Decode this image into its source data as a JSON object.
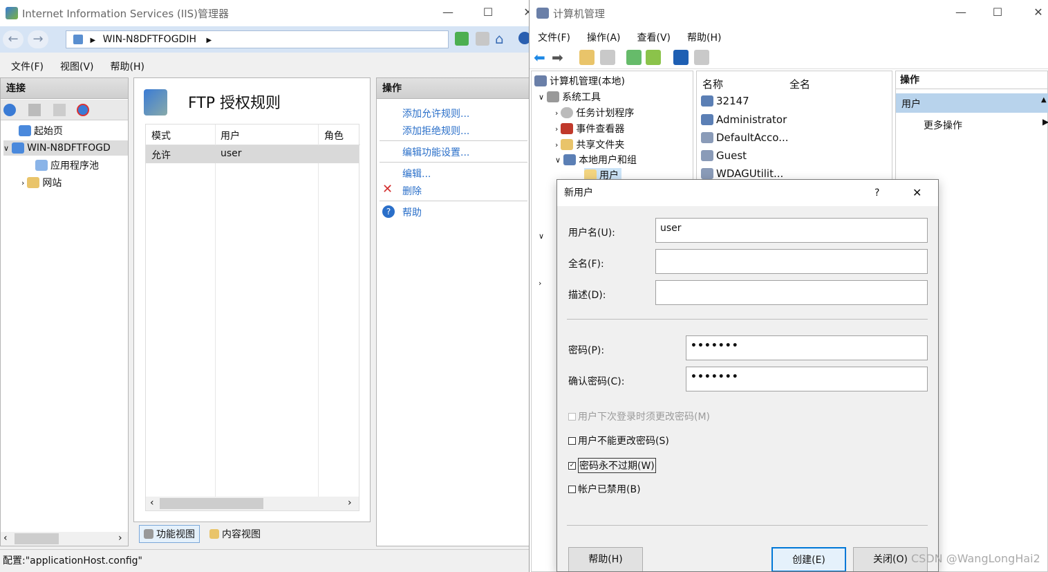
{
  "iis": {
    "title": "Internet Information Services (IIS)管理器",
    "address": "WIN-N8DFTFOGDIH",
    "menu": [
      "文件(F)",
      "视图(V)",
      "帮助(H)"
    ],
    "connections_header": "连接",
    "tree": {
      "start_page": "起始页",
      "server": "WIN-N8DFTFOGD",
      "app_pools": "应用程序池",
      "sites": "网站"
    },
    "content": {
      "title": "FTP 授权规则",
      "columns": [
        "模式",
        "用户",
        "角色"
      ],
      "rows": [
        {
          "mode": "允许",
          "user": "user",
          "role": ""
        }
      ]
    },
    "actions": {
      "header": "操作",
      "add_allow": "添加允许规则...",
      "add_deny": "添加拒绝规则...",
      "edit_settings": "编辑功能设置...",
      "edit": "编辑...",
      "delete": "删除",
      "help": "帮助"
    },
    "view_tabs": {
      "features": "功能视图",
      "content": "内容视图"
    },
    "status": "配置:\"applicationHost.config\""
  },
  "cm": {
    "title": "计算机管理",
    "menu": [
      "文件(F)",
      "操作(A)",
      "查看(V)",
      "帮助(H)"
    ],
    "tree": {
      "root": "计算机管理(本地)",
      "system_tools": "系统工具",
      "task_scheduler": "任务计划程序",
      "event_viewer": "事件查看器",
      "shared_folders": "共享文件夹",
      "local_users": "本地用户和组",
      "users": "用户"
    },
    "list": {
      "col_name": "名称",
      "col_fullname": "全名",
      "items": [
        "32147",
        "Administrator",
        "DefaultAcco...",
        "Guest",
        "WDAGUtilit..."
      ]
    },
    "actions": {
      "header": "操作",
      "section": "用户",
      "more": "更多操作"
    }
  },
  "dialog": {
    "title": "新用户",
    "help_glyph": "?",
    "username_label": "用户名(U):",
    "username_value": "user",
    "fullname_label": "全名(F):",
    "fullname_value": "",
    "desc_label": "描述(D):",
    "desc_value": "",
    "password_label": "密码(P):",
    "password_value": "•••••••",
    "confirm_label": "确认密码(C):",
    "confirm_value": "•••••••",
    "cb_must_change": "用户下次登录时须更改密码(M)",
    "cb_cannot_change": "用户不能更改密码(S)",
    "cb_never_expires": "密码永不过期(W)",
    "cb_disabled": "帐户已禁用(B)",
    "btn_help": "帮助(H)",
    "btn_create": "创建(E)",
    "btn_close": "关闭(O)"
  },
  "watermark": "CSDN @WangLongHai2"
}
